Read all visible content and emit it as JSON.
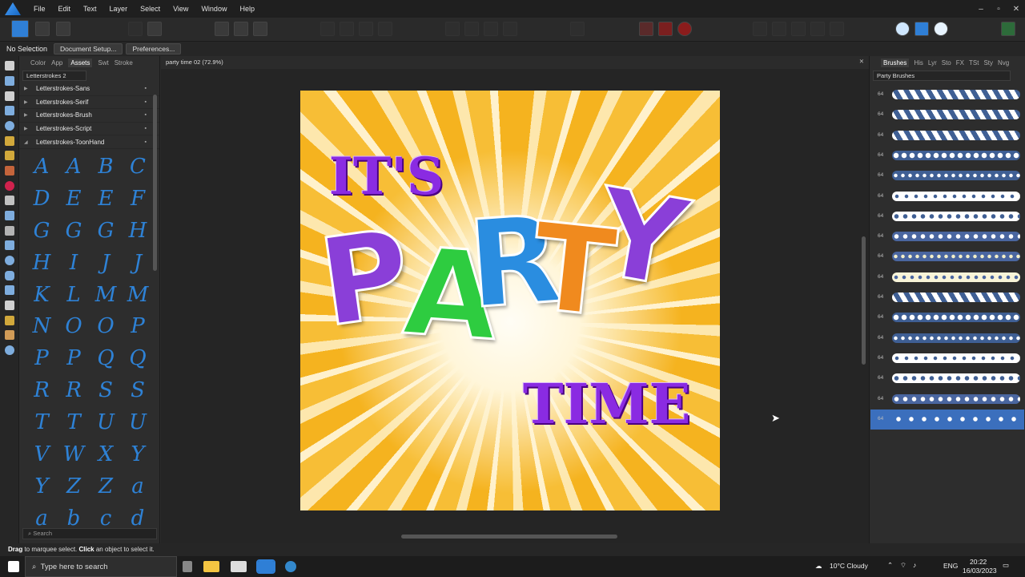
{
  "menubar": {
    "items": [
      "File",
      "Edit",
      "Text",
      "Layer",
      "Select",
      "View",
      "Window",
      "Help"
    ],
    "min": "–",
    "max": "▫",
    "close": "✕"
  },
  "context": {
    "selection": "No Selection",
    "doc_setup": "Document Setup...",
    "prefs": "Preferences..."
  },
  "left_panel": {
    "tabs": [
      "Color",
      "App",
      "Assets",
      "Swt",
      "Stroke"
    ],
    "active_tab": "Assets",
    "dropdown": "Letterstrokes 2",
    "categories": [
      "Letterstrokes-Sans",
      "Letterstrokes-Serif",
      "Letterstrokes-Brush",
      "Letterstrokes-Script",
      "Letterstrokes-ToonHand"
    ],
    "glyphs": [
      "A",
      "A",
      "B",
      "C",
      "D",
      "E",
      "E",
      "F",
      "G",
      "G",
      "G",
      "H",
      "H",
      "I",
      "J",
      "J",
      "K",
      "L",
      "M",
      "M",
      "N",
      "O",
      "O",
      "P",
      "P",
      "P",
      "Q",
      "Q",
      "R",
      "R",
      "S",
      "S",
      "T",
      "T",
      "U",
      "U",
      "V",
      "W",
      "X",
      "Y",
      "Y",
      "Z",
      "Z",
      "a",
      "a",
      "b",
      "c",
      "d"
    ],
    "search_placeholder": "Search"
  },
  "document": {
    "tab_title": "party time 02 (72.9%)",
    "close": "✕"
  },
  "artwork": {
    "line1": "IT'S",
    "party": [
      "P",
      "A",
      "R",
      "T",
      "Y"
    ],
    "line3": "TIME"
  },
  "right_panel": {
    "tabs": [
      "Brushes",
      "His",
      "Lyr",
      "Sto",
      "FX",
      "TSt",
      "Sty",
      "Nvg"
    ],
    "active_tab": "Brushes",
    "category": "Party Brushes",
    "brush_size_label": "64",
    "brush_count": 17,
    "selected_index": 16
  },
  "status": {
    "drag": "Drag",
    "drag_rest": " to marquee select. ",
    "click": "Click",
    "click_rest": " an object to select it."
  },
  "taskbar": {
    "search": "Type here to search",
    "weather": "10°C  Cloudy",
    "lang": "ENG",
    "time": "20:22",
    "date": "16/03/2023"
  },
  "colors": {
    "accent": "#3b6fbd",
    "glyph": "#2e82d6",
    "purple": "#8a2be2",
    "green": "#2ecc40",
    "blue": "#2a8de0",
    "orange": "#f08a1e"
  }
}
